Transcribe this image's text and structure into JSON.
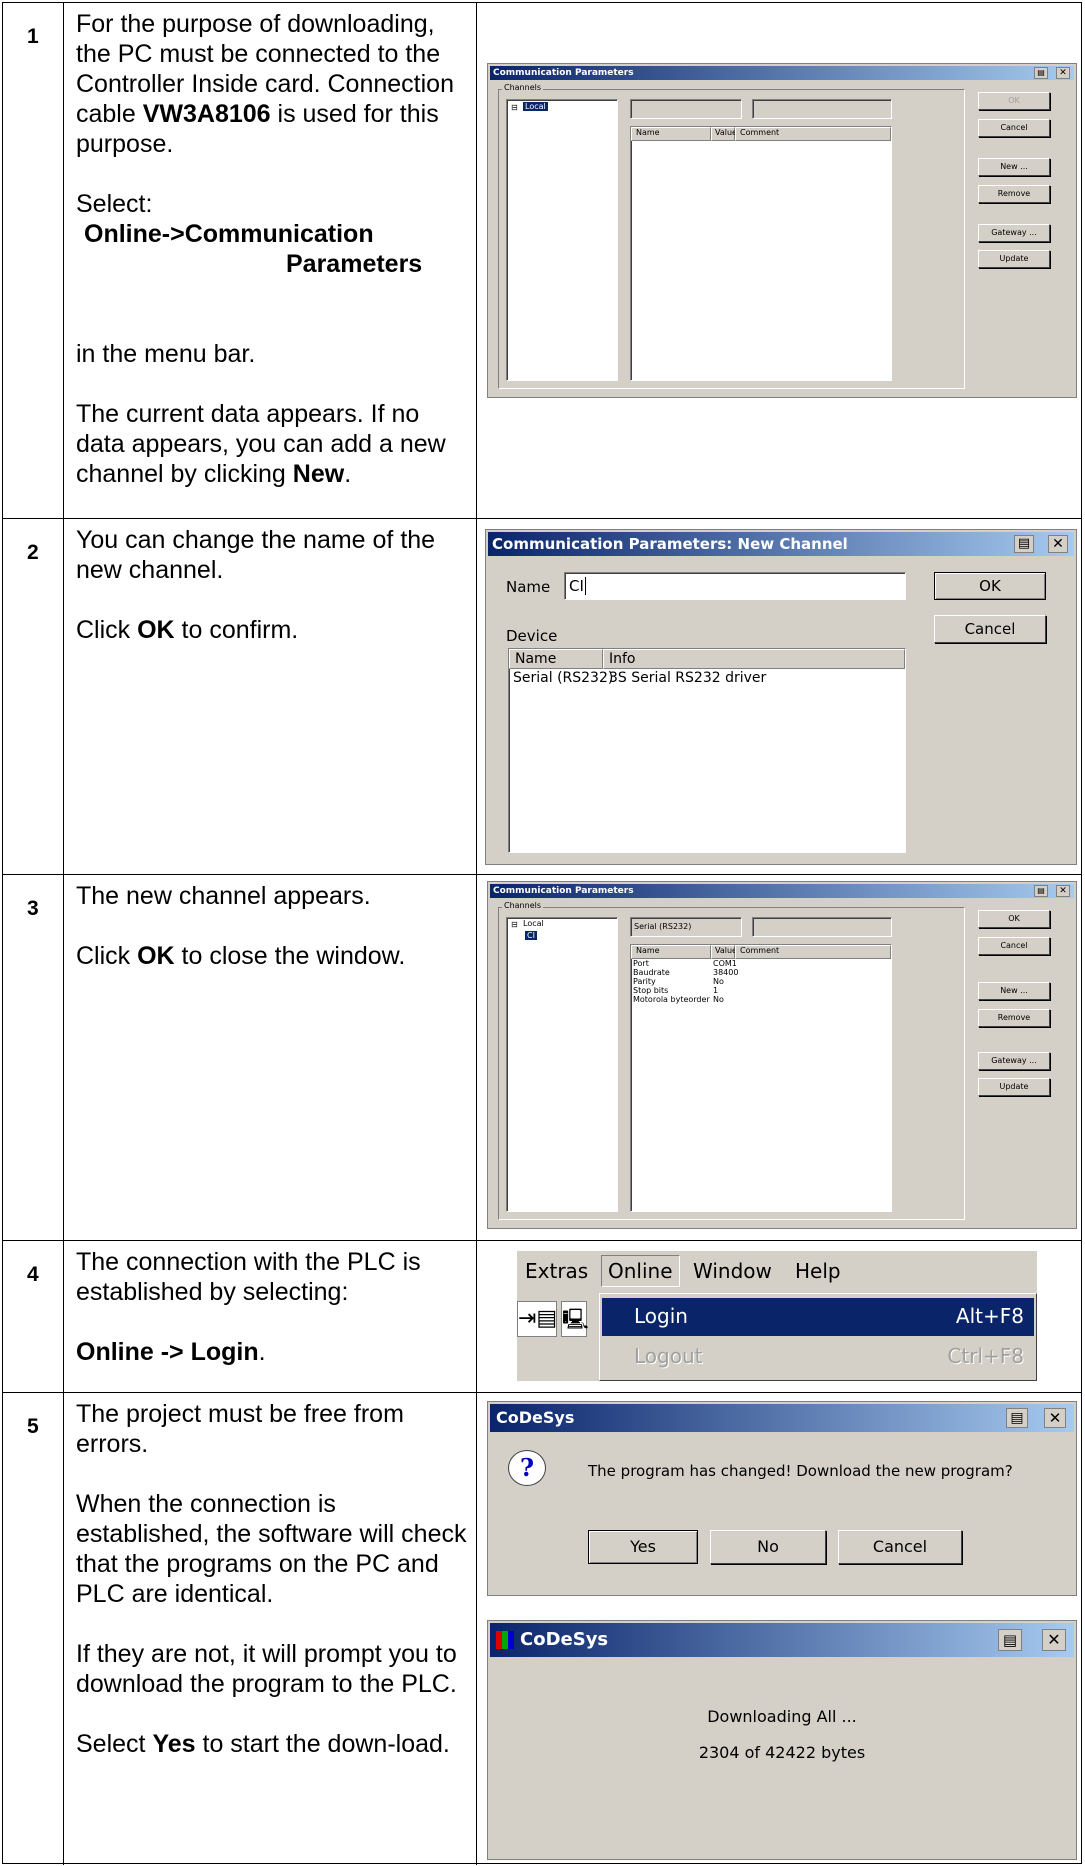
{
  "rows": [
    {
      "num": "1",
      "text": {
        "l1": "For the purpose of downloading, the PC must be connected to the Controller Inside card. Connection cable ",
        "l1_bold": "VW3A8106",
        "l1_end": " is used for this purpose.",
        "select": "Select:",
        "menu1": "Online->Communication",
        "menu2": "Parameters",
        "menu_bar": "in the menu bar.",
        "current": "The current data appears. If no data appears, you can add a new channel by clicking ",
        "current_bold": "New",
        "current_end": "."
      },
      "win": {
        "title": "Communication Parameters",
        "channels": "Channels",
        "tree_local": "Local",
        "col_name": "Name",
        "col_value": "Value",
        "col_comment": "Comment",
        "btn_ok": "OK",
        "btn_cancel": "Cancel",
        "btn_new": "New ...",
        "btn_remove": "Remove",
        "btn_gateway": "Gateway ...",
        "btn_update": "Update"
      }
    },
    {
      "num": "2",
      "text": {
        "l1": "You can change the name of the new channel.",
        "l2": "Click ",
        "l2_bold": "OK",
        "l2_end": " to confirm."
      },
      "win": {
        "title": "Communication Parameters: New Channel",
        "name_label": "Name",
        "name_value": "CI",
        "btn_ok": "OK",
        "btn_cancel": "Cancel",
        "device_label": "Device",
        "col_name": "Name",
        "col_info": "Info",
        "dev_name": "Serial (RS232)",
        "dev_info": "3S Serial RS232 driver"
      }
    },
    {
      "num": "3",
      "text": {
        "l1": "The new channel appears.",
        "l2": "Click ",
        "l2_bold": "OK",
        "l2_end": " to close the window."
      },
      "win": {
        "title": "Communication Parameters",
        "channels": "Channels",
        "tree_local": "Local",
        "tree_ci": "CI",
        "field1": "Serial (RS232)",
        "col_name": "Name",
        "col_value": "Value",
        "col_comment": "Comment",
        "params": [
          {
            "name": "Port",
            "value": "COM1"
          },
          {
            "name": "Baudrate",
            "value": "38400"
          },
          {
            "name": "Parity",
            "value": "No"
          },
          {
            "name": "Stop bits",
            "value": "1"
          },
          {
            "name": "Motorola byteorder",
            "value": "No"
          }
        ],
        "btn_ok": "OK",
        "btn_cancel": "Cancel",
        "btn_new": "New ...",
        "btn_remove": "Remove",
        "btn_gateway": "Gateway ...",
        "btn_update": "Update"
      }
    },
    {
      "num": "4",
      "text": {
        "l1": "The connection with the PLC is established by selecting:",
        "l2_bold": "Online -> Login",
        "l2_end": "."
      },
      "menu": {
        "extras": "Extras",
        "online": "Online",
        "window": "Window",
        "help": "Help",
        "login": "Login",
        "login_key": "Alt+F8",
        "logout": "Logout",
        "logout_key": "Ctrl+F8"
      }
    },
    {
      "num": "5",
      "text": {
        "l1": "The project must be free from errors.",
        "l2": "When the connection is established, the software will check that the programs on the PC and PLC are identical.",
        "l3": "If they are not, it will prompt you to download the program to the PLC.",
        "l4": "Select ",
        "l4_bold": "Yes",
        "l4_end": " to start the down-load."
      },
      "dialog1": {
        "title": "CoDeSys",
        "message": "The program has changed! Download the new program?",
        "btn_yes": "Yes",
        "btn_no": "No",
        "btn_cancel": "Cancel"
      },
      "dialog2": {
        "title": "CoDeSys",
        "line1": "Downloading All ...",
        "line2": "2304 of 42422 bytes"
      }
    }
  ]
}
